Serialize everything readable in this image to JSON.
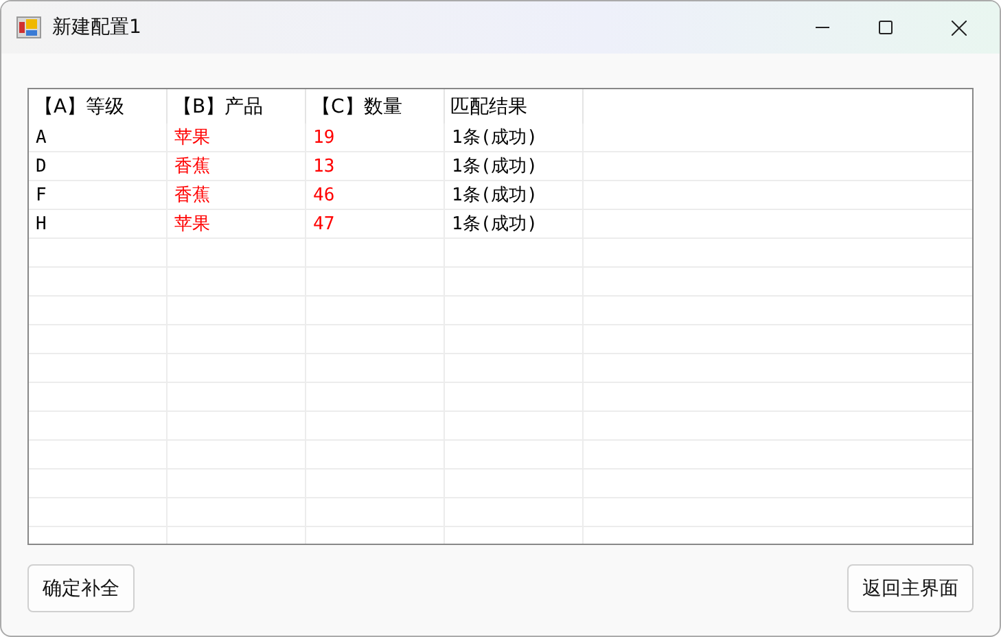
{
  "window": {
    "title": "新建配置1"
  },
  "table": {
    "columns": [
      {
        "label": "【A】等级",
        "color": "#000000"
      },
      {
        "label": "【B】产品",
        "color": "#ff0000"
      },
      {
        "label": "【C】数量",
        "color": "#ff0000"
      },
      {
        "label": "匹配结果",
        "color": "#000000"
      }
    ],
    "rows": [
      [
        "A",
        "苹果",
        "19",
        "1条(成功)"
      ],
      [
        "D",
        "香蕉",
        "13",
        "1条(成功)"
      ],
      [
        "F",
        "香蕉",
        "46",
        "1条(成功)"
      ],
      [
        "H",
        "苹果",
        "47",
        "1条(成功)"
      ]
    ]
  },
  "buttons": [
    "确定补全",
    "返回主界面"
  ]
}
